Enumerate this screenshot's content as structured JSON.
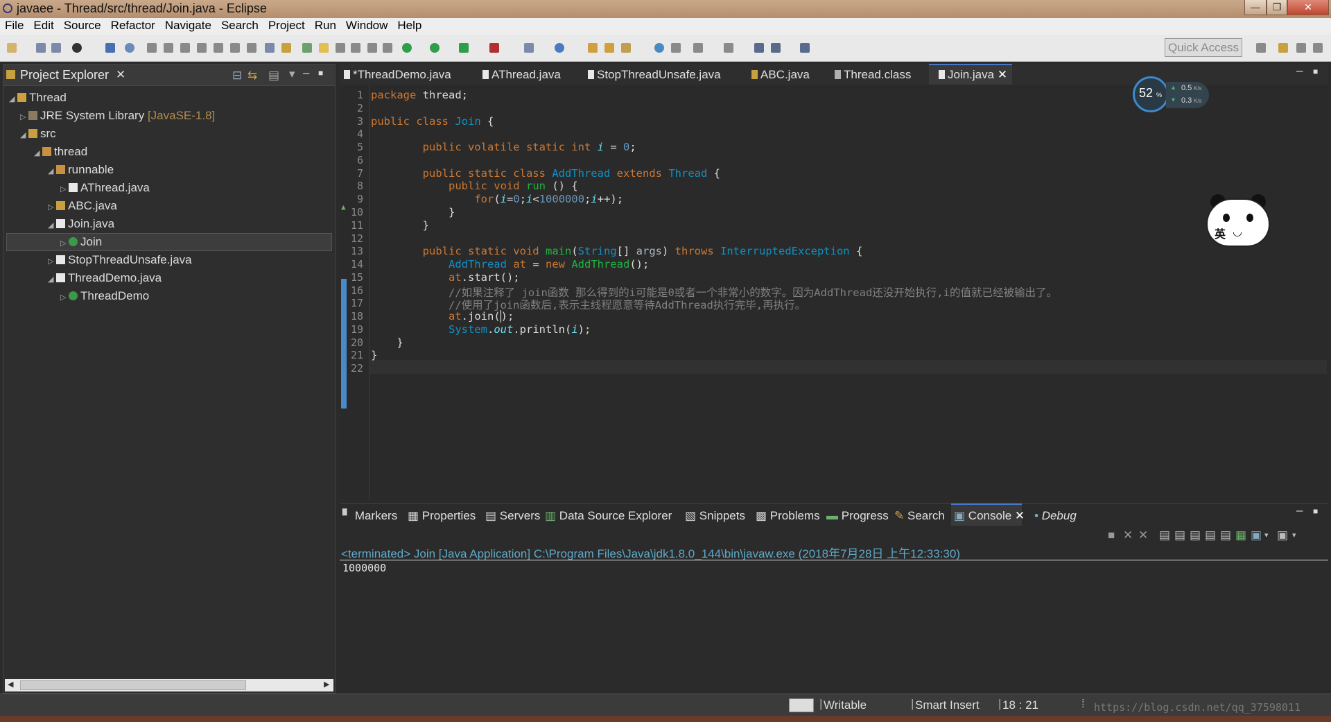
{
  "window": {
    "title": "javaee - Thread/src/thread/Join.java - Eclipse"
  },
  "menu": [
    "File",
    "Edit",
    "Source",
    "Refactor",
    "Navigate",
    "Search",
    "Project",
    "Run",
    "Window",
    "Help"
  ],
  "toolbar": {
    "quick_access_placeholder": "Quick Access"
  },
  "explorer": {
    "title": "Project Explorer",
    "tree": [
      {
        "label": "Thread",
        "extra": ""
      },
      {
        "label": "JRE System Library",
        "extra": "[JavaSE-1.8]"
      },
      {
        "label": "src",
        "extra": ""
      },
      {
        "label": "thread",
        "extra": ""
      },
      {
        "label": "runnable",
        "extra": ""
      },
      {
        "label": "AThread.java",
        "extra": ""
      },
      {
        "label": "ABC.java",
        "extra": ""
      },
      {
        "label": "Join.java",
        "extra": ""
      },
      {
        "label": "Join",
        "extra": ""
      },
      {
        "label": "StopThreadUnsafe.java",
        "extra": ""
      },
      {
        "label": "ThreadDemo.java",
        "extra": ""
      },
      {
        "label": "ThreadDemo",
        "extra": ""
      }
    ]
  },
  "editor": {
    "tabs": [
      "*ThreadDemo.java",
      "AThread.java",
      "StopThreadUnsafe.java",
      "ABC.java",
      "Thread.class",
      "Join.java"
    ],
    "active_tab": "Join.java",
    "line_numbers": [
      "1",
      "2",
      "3",
      "4",
      "5",
      "6",
      "7",
      "8",
      "9",
      "10",
      "11",
      "12",
      "13",
      "14",
      "15",
      "16",
      "17",
      "18",
      "19",
      "20",
      "21",
      "22"
    ],
    "comment_line_16": "//如果注释了 join函数 那么得到的i可能是0或者一个非常小的数字。因为AddThread还没开始执行,i的值就已经被输出了。",
    "comment_line_17": "//使用了join函数后,表示主线程愿意等待AddThread执行完毕,再执行。"
  },
  "netmon": {
    "percent": "52",
    "unit": "%",
    "up": "0.5",
    "down": "0.3",
    "rate_unit": "K/s"
  },
  "ime": {
    "label": "英"
  },
  "bottom": {
    "tabs": [
      "Markers",
      "Properties",
      "Servers",
      "Data Source Explorer",
      "Snippets",
      "Problems",
      "Progress",
      "Search",
      "Console",
      "Debug"
    ],
    "active_tab": "Console",
    "console_header": "<terminated> Join [Java Application] C:\\Program Files\\Java\\jdk1.8.0_144\\bin\\javaw.exe (2018年7月28日 上午12:33:30)",
    "console_output": "1000000"
  },
  "status": {
    "writable": "Writable",
    "insert_mode": "Smart Insert",
    "position": "18 : 21",
    "watermark": "https://blog.csdn.net/qq_37598011"
  },
  "colors": {
    "accent_blue": "#2f65ca",
    "console_header": "#5fa8c8"
  }
}
